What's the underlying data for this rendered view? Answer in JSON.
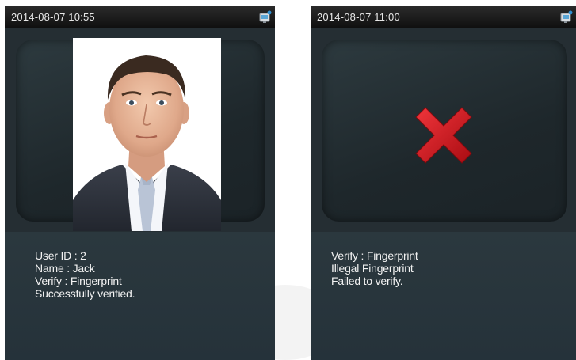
{
  "left_screen": {
    "timestamp": "2014-08-07 10:55",
    "icon": "network-connected-icon",
    "photo": "user-portrait-photo",
    "lines": {
      "user_id": "User ID : 2",
      "name": "Name : Jack",
      "verify": "Verify : Fingerprint",
      "result": "Successfully verified."
    }
  },
  "right_screen": {
    "timestamp": "2014-08-07 11:00",
    "icon": "network-connected-icon",
    "status_icon": "red-x-icon",
    "lines": {
      "verify": "Verify : Fingerprint",
      "reason": "Illegal Fingerprint",
      "result": "Failed to verify."
    }
  },
  "colors": {
    "screen_bg": "#1f2a30",
    "status_bar": "#111111",
    "text": "#f2f2f2",
    "error_red": "#d8141b"
  }
}
